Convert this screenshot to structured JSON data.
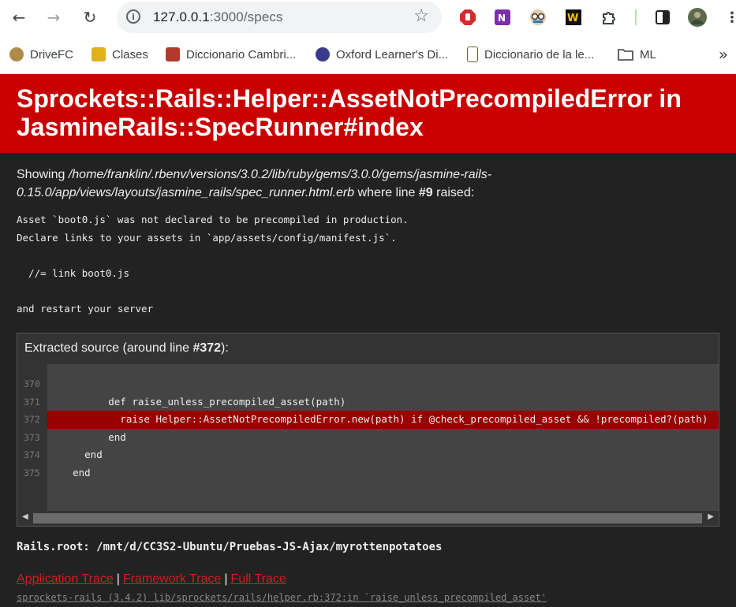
{
  "browser": {
    "url_host": "127.0.0.1",
    "url_rest": ":3000/specs",
    "bookmarks": [
      {
        "label": "DriveFC",
        "color": "#b08a4a"
      },
      {
        "label": "Clases",
        "color": "#e0b21a"
      },
      {
        "label": "Diccionario Cambri...",
        "color": "#b33a2a"
      },
      {
        "label": "Oxford Learner's Di...",
        "color": "#3a3a8a"
      },
      {
        "label": "Diccionario de la le...",
        "color": "#7a5a2a"
      },
      {
        "label": "ML",
        "color": "#ffffff"
      }
    ],
    "more_bookmarks": "»"
  },
  "error": {
    "title": "Sprockets::Rails::Helper::AssetNotPrecompiledError in JasmineRails::SpecRunner#index",
    "showing_prefix": "Showing ",
    "showing_path": "/home/franklin/.rbenv/versions/3.0.2/lib/ruby/gems/3.0.0/gems/jasmine-rails-0.15.0/app/views/layouts/jasmine_rails/spec_runner.html.erb",
    "showing_mid": " where line ",
    "showing_line": "#9",
    "showing_suffix": " raised:",
    "message": "Asset `boot0.js` was not declared to be precompiled in production.\nDeclare links to your assets in `app/assets/config/manifest.js`.\n\n  //= link boot0.js\n\nand restart your server"
  },
  "source": {
    "title_prefix": "Extracted source (around line ",
    "title_line": "#372",
    "title_suffix": "):",
    "lines": [
      {
        "num": "370",
        "text": ""
      },
      {
        "num": "371",
        "text": "          def raise_unless_precompiled_asset(path)"
      },
      {
        "num": "372",
        "text": "            raise Helper::AssetNotPrecompiledError.new(path) if @check_precompiled_asset && !precompiled?(path)"
      },
      {
        "num": "373",
        "text": "          end"
      },
      {
        "num": "374",
        "text": "      end"
      },
      {
        "num": "375",
        "text": "    end"
      }
    ],
    "highlight_line": "372"
  },
  "rails_root": "Rails.root: /mnt/d/CC3S2-Ubuntu/Pruebas-JS-Ajax/myrottenpotatoes",
  "traces": {
    "application": "Application Trace",
    "framework": "Framework Trace",
    "full": "Full Trace",
    "separator": "|",
    "first_line": "sprockets-rails (3.4.2) lib/sprockets/rails/helper.rb:372:in `raise_unless_precompiled_asset'"
  }
}
